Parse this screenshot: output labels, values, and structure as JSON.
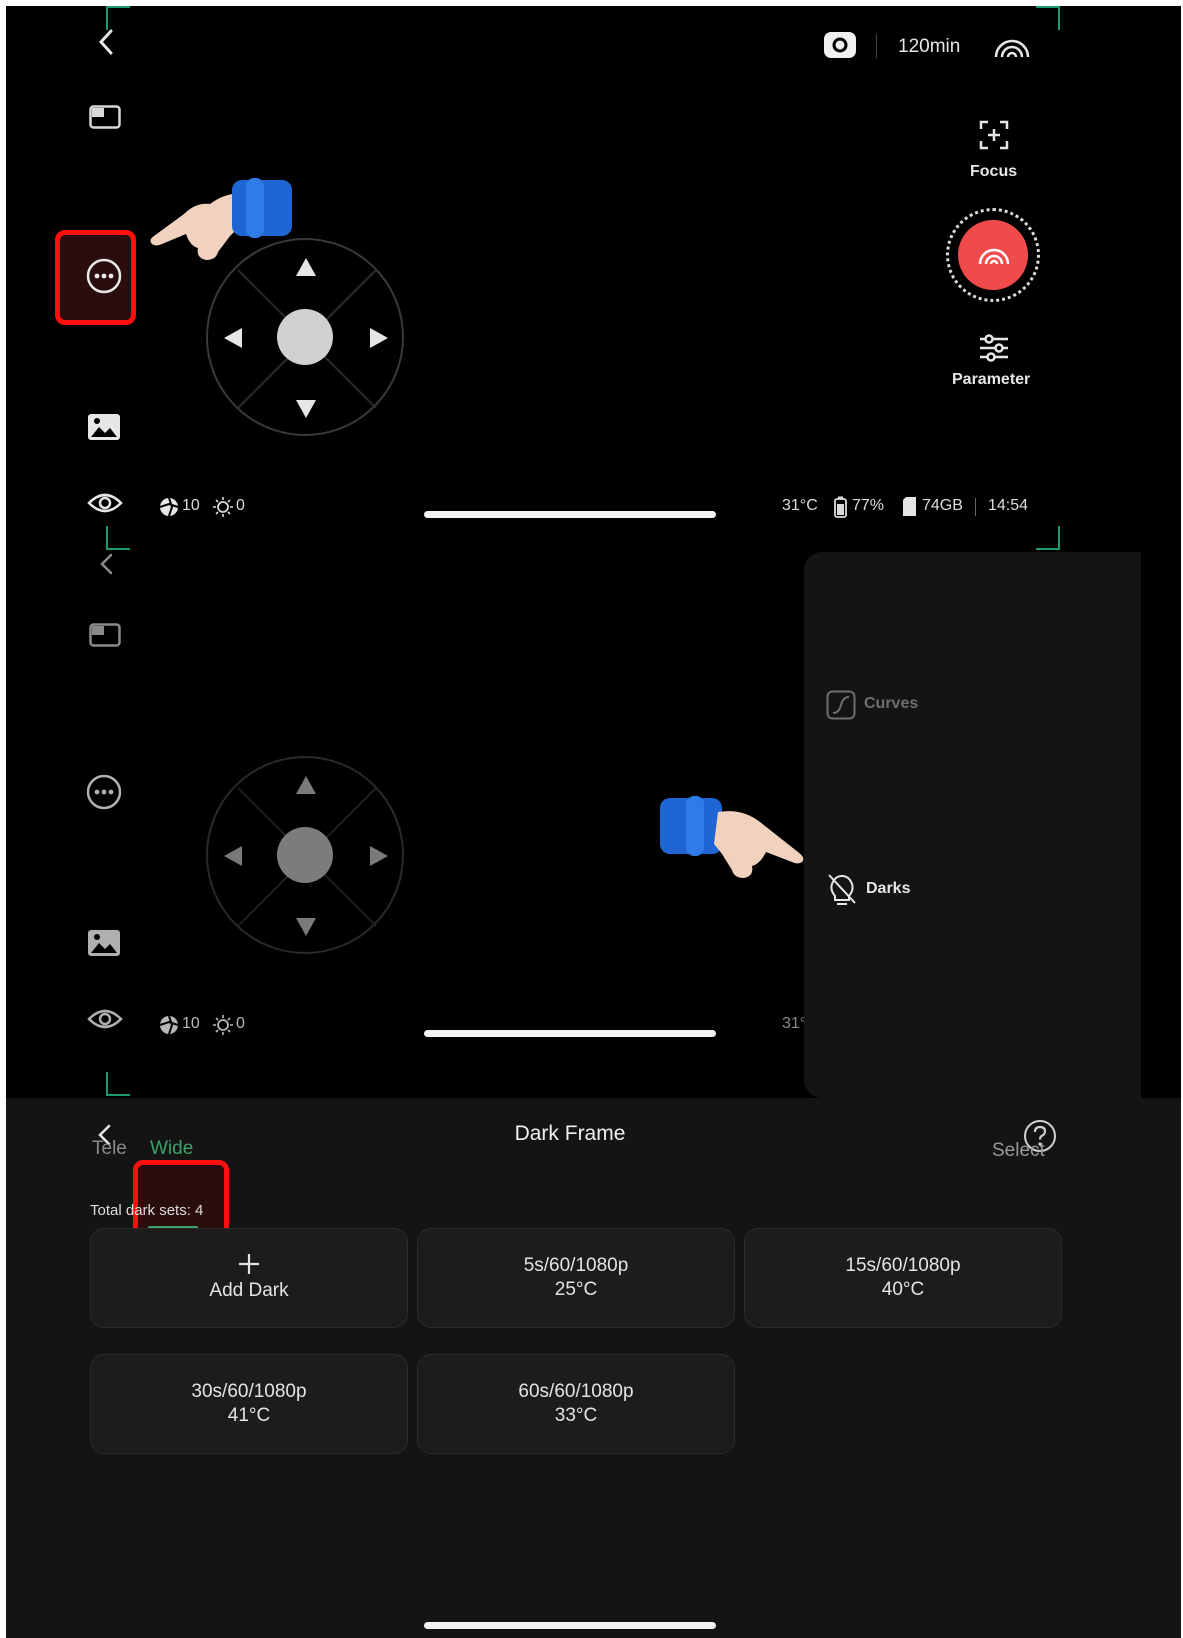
{
  "top_bar": {
    "record_time": "120min"
  },
  "right_controls": {
    "focus_label": "Focus",
    "parameter_label": "Parameter"
  },
  "status_left": {
    "exposure_count": "10",
    "light_value": "0"
  },
  "status_right": {
    "temperature": "31°C",
    "battery": "77%",
    "storage": "74GB",
    "time": "14:54"
  },
  "screen2": {
    "exposure_count": "10",
    "light_value": "0",
    "temperature_partial": "31°"
  },
  "menu_panel": {
    "items": [
      {
        "label": "Curves",
        "icon": "curves-icon"
      },
      {
        "label": "Darks",
        "icon": "darks-icon"
      }
    ]
  },
  "dark_frame": {
    "title": "Dark Frame",
    "tabs": [
      {
        "label": "Tele",
        "active": false
      },
      {
        "label": "Wide",
        "active": true
      }
    ],
    "select_label": "Select",
    "total_label": "Total dark sets: 4",
    "add_dark_label": "Add Dark",
    "sets": [
      {
        "params": "5s/60/1080p",
        "temp": "25°C"
      },
      {
        "params": "15s/60/1080p",
        "temp": "40°C"
      },
      {
        "params": "30s/60/1080p",
        "temp": "41°C"
      },
      {
        "params": "60s/60/1080p",
        "temp": "33°C"
      }
    ]
  },
  "colors": {
    "accent_green": "#1e9a6a",
    "tab_active": "#3fa06b",
    "shutter_red": "#ef4b4b",
    "highlight_red": "#ff0f0f",
    "background": "#000000",
    "panel_bg": "#141414"
  }
}
